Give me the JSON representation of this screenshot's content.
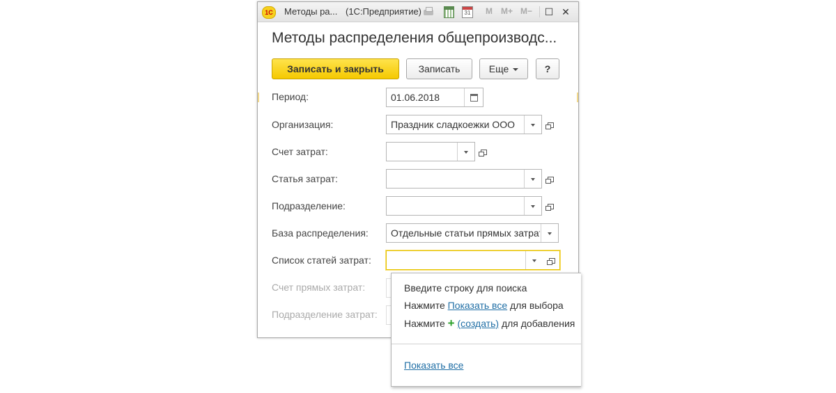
{
  "window": {
    "title": "Методы ра...",
    "app_suffix": "(1С:Предприятие)",
    "logo_text": "1С",
    "calendar_day": "31",
    "mem_buttons": [
      "M",
      "M+",
      "M−"
    ]
  },
  "form": {
    "title": "Методы распределения общепроизводс..."
  },
  "toolbar": {
    "save_close": "Записать и закрыть",
    "save": "Записать",
    "more": "Еще",
    "help": "?"
  },
  "fields": {
    "period": {
      "label": "Период:",
      "value": "01.06.2018"
    },
    "organization": {
      "label": "Организация:",
      "value": "Праздник сладкоежки ООО"
    },
    "cost_account": {
      "label": "Счет затрат:",
      "value": ""
    },
    "cost_item": {
      "label": "Статья затрат:",
      "value": ""
    },
    "department": {
      "label": "Подразделение:",
      "value": ""
    },
    "distribution_base": {
      "label": "База распределения:",
      "value": "Отдельные статьи прямых затрат"
    },
    "cost_items_list": {
      "label": "Список статей затрат:",
      "value": ""
    },
    "direct_cost_account": {
      "label": "Счет прямых затрат:"
    },
    "cost_department": {
      "label": "Подразделение затрат:"
    }
  },
  "dropdown": {
    "line1": "Введите строку для поиска",
    "line2_prefix": "Нажмите",
    "line2_link": "Показать все",
    "line2_suffix": "для выбора",
    "line3_prefix": "Нажмите",
    "line3_icon": "+",
    "line3_link": "(создать)",
    "line3_suffix": "для добавления",
    "show_all": "Показать все"
  }
}
